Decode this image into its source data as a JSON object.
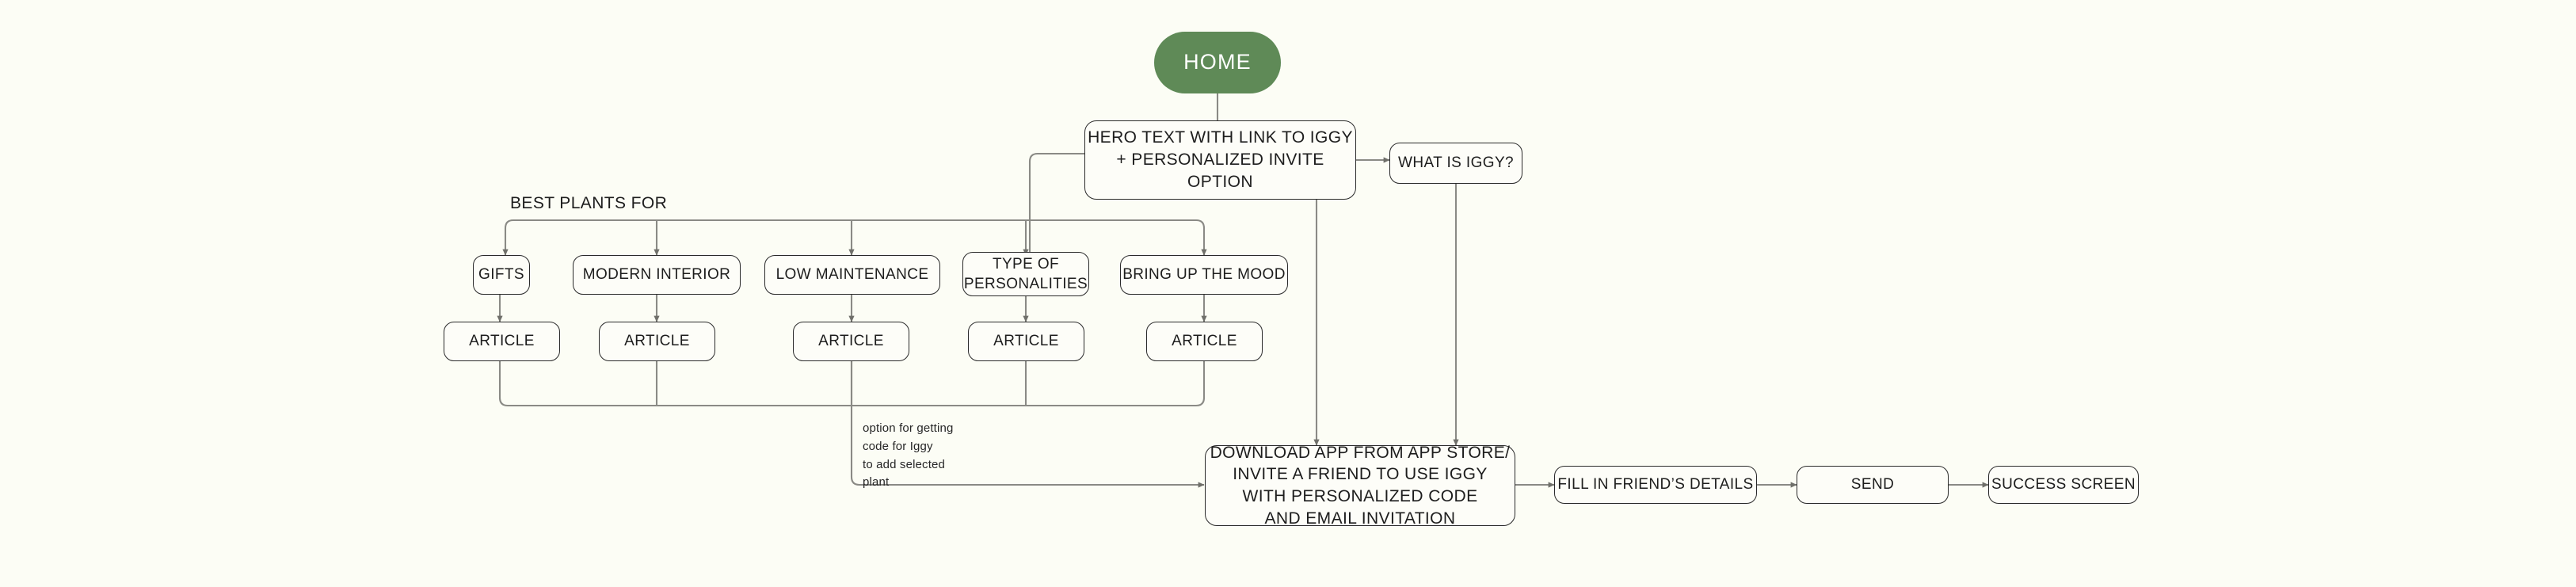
{
  "diagram": {
    "title": "Iggy plant app site flow diagram",
    "background_color": "#fcfdf5",
    "accent_color": "#5f8a57",
    "line_color": "#8a8a85",
    "node_border_color": "#2a2a2a",
    "nodes": {
      "home": "HOME",
      "hero": "HERO TEXT WITH LINK TO IGGY\n+ PERSONALIZED INVITE OPTION",
      "what_is_iggy": "WHAT IS IGGY?",
      "best_plants_label": "BEST PLANTS FOR",
      "categories": [
        "GIFTS",
        "MODERN INTERIOR",
        "LOW MAINTENANCE",
        "TYPE OF\nPERSONALITIES",
        "BRING UP THE MOOD"
      ],
      "articles": [
        "ARTICLE",
        "ARTICLE",
        "ARTICLE",
        "ARTICLE",
        "ARTICLE"
      ],
      "annotation": "option for getting\ncode for Iggy\nto add selected\nplant",
      "download": "DOWNLOAD APP FROM APP STORE/\nINVITE A FRIEND TO USE IGGY\nWITH PERSONALIZED CODE\nAND EMAIL INVITATION",
      "fill_details": "FILL IN FRIEND’S DETAILS",
      "send": "SEND",
      "success": "SUCCESS SCREEN"
    }
  }
}
